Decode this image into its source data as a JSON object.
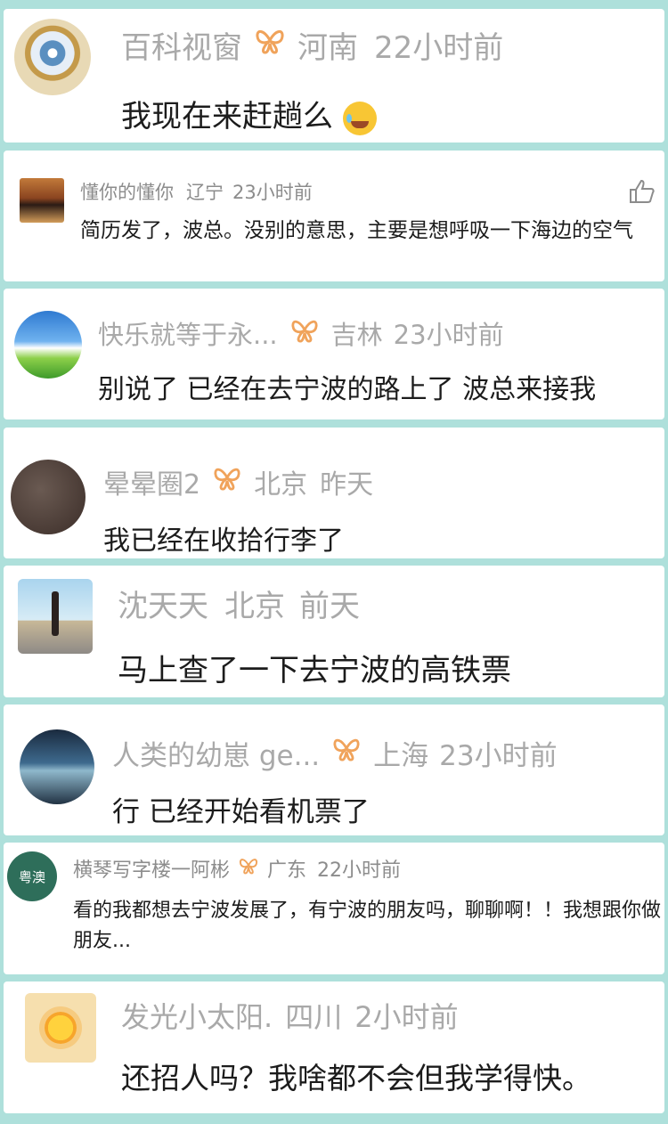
{
  "colors": {
    "background": "#aee0db",
    "card": "#ffffff",
    "meta": "#a9a9a9",
    "text": "#1c1c1c",
    "badge": "#f0a35b"
  },
  "comments": [
    {
      "name": "百科视窗",
      "region": "河南",
      "time": "22小时前",
      "badge": "butterfly-badge-icon",
      "text": "我现在来赶趟么",
      "emoji": "laugh-cry-emoji"
    },
    {
      "name": "懂你的懂你",
      "region": "辽宁",
      "time": "23小时前",
      "like_icon": "thumbs-up-icon",
      "text": "简历发了，波总。没别的意思，主要是想呼吸一下海边的空气"
    },
    {
      "name": "快乐就等于永...",
      "region": "吉林",
      "time": "23小时前",
      "badge": "butterfly-badge-icon",
      "text": "别说了 已经在去宁波的路上了 波总来接我"
    },
    {
      "name": "晕晕圈2",
      "region": "北京",
      "time": "昨天",
      "badge": "butterfly-badge-icon",
      "text": "我已经在收拾行李了"
    },
    {
      "name": "沈天天",
      "region": "北京",
      "time": "前天",
      "text": "马上查了一下去宁波的高铁票"
    },
    {
      "name": "人类的幼崽 ge...",
      "region": "上海",
      "time": "23小时前",
      "badge": "butterfly-badge-icon",
      "text": "行 已经开始看机票了"
    },
    {
      "name": "横琴写字楼一阿彬",
      "region": "广东",
      "time": "22小时前",
      "badge": "butterfly-badge-icon",
      "text": "看的我都想去宁波发展了，有宁波的朋友吗，聊聊啊！！我想跟你做朋友...",
      "avatar_text": "粤澳"
    },
    {
      "name": "发光小太阳.",
      "region": "四川",
      "time": "2小时前",
      "text": "还招人吗？我啥都不会但我学得快。"
    }
  ]
}
